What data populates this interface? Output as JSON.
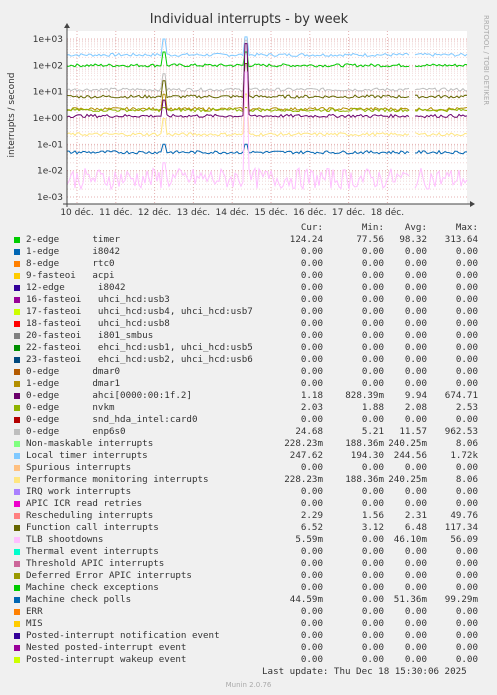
{
  "chart_data": {
    "type": "line",
    "title": "Individual interrupts - by week",
    "ylabel": "interrupts / second",
    "side_label": "RRDTOOL / TOBI OETIKER",
    "y_scale": "log",
    "ylim": [
      0.001,
      1000
    ],
    "y_ticks": [
      "1e+03",
      "1e+02",
      "1e+01",
      "1e+00",
      "1e-01",
      "1e-02",
      "1e-03"
    ],
    "x_ticks": [
      "10 déc.",
      "11 déc.",
      "12 déc.",
      "13 déc.",
      "14 déc.",
      "15 déc.",
      "16 déc.",
      "17 déc.",
      "18 déc."
    ],
    "grid": true,
    "columns": [
      "Cur:",
      "Min:",
      "Avg:",
      "Max:"
    ],
    "series": [
      {
        "name": "2-edge      timer",
        "color": "#00cc00",
        "values": [
          "124.24",
          "77.56",
          "98.32",
          "313.64"
        ]
      },
      {
        "name": "1-edge      i8042",
        "color": "#0066b3",
        "values": [
          "0.00",
          "0.00",
          "0.00",
          "0.00"
        ]
      },
      {
        "name": "8-edge      rtc0",
        "color": "#ff8000",
        "values": [
          "0.00",
          "0.00",
          "0.00",
          "0.00"
        ]
      },
      {
        "name": "9-fasteoi   acpi",
        "color": "#ffcc00",
        "values": [
          "0.00",
          "0.00",
          "0.00",
          "0.00"
        ]
      },
      {
        "name": "12-edge      i8042",
        "color": "#330099",
        "values": [
          "0.00",
          "0.00",
          "0.00",
          "0.00"
        ]
      },
      {
        "name": "16-fasteoi   uhci_hcd:usb3",
        "color": "#990099",
        "values": [
          "0.00",
          "0.00",
          "0.00",
          "0.00"
        ]
      },
      {
        "name": "17-fasteoi   uhci_hcd:usb4, uhci_hcd:usb7",
        "color": "#ccff00",
        "values": [
          "0.00",
          "0.00",
          "0.00",
          "0.00"
        ]
      },
      {
        "name": "18-fasteoi   uhci_hcd:usb8",
        "color": "#ff0000",
        "values": [
          "0.00",
          "0.00",
          "0.00",
          "0.00"
        ]
      },
      {
        "name": "20-fasteoi   i801_smbus",
        "color": "#808080",
        "values": [
          "0.00",
          "0.00",
          "0.00",
          "0.00"
        ]
      },
      {
        "name": "22-fasteoi   ehci_hcd:usb1, uhci_hcd:usb5",
        "color": "#008f00",
        "values": [
          "0.00",
          "0.00",
          "0.00",
          "0.00"
        ]
      },
      {
        "name": "23-fasteoi   ehci_hcd:usb2, uhci_hcd:usb6",
        "color": "#00487d",
        "values": [
          "0.00",
          "0.00",
          "0.00",
          "0.00"
        ]
      },
      {
        "name": "0-edge      dmar0",
        "color": "#b35a00",
        "values": [
          "0.00",
          "0.00",
          "0.00",
          "0.00"
        ]
      },
      {
        "name": "1-edge      dmar1",
        "color": "#b38f00",
        "values": [
          "0.00",
          "0.00",
          "0.00",
          "0.00"
        ]
      },
      {
        "name": "0-edge      ahci[0000:00:1f.2]",
        "color": "#6b006b",
        "values": [
          "1.18",
          "828.39m",
          "9.94",
          "674.71"
        ]
      },
      {
        "name": "0-edge      nvkm",
        "color": "#8fb300",
        "values": [
          "2.03",
          "1.88",
          "2.08",
          "2.53"
        ]
      },
      {
        "name": "0-edge      snd_hda_intel:card0",
        "color": "#b30000",
        "values": [
          "0.00",
          "0.00",
          "0.00",
          "0.00"
        ]
      },
      {
        "name": "0-edge      enp6s0",
        "color": "#bebebe",
        "values": [
          "24.68",
          "5.21",
          "11.57",
          "962.53"
        ]
      },
      {
        "name": "Non-maskable interrupts",
        "color": "#80ff80",
        "values": [
          "228.23m",
          "188.36m",
          "240.25m",
          "8.06"
        ]
      },
      {
        "name": "Local timer interrupts",
        "color": "#80c9ff",
        "values": [
          "247.62",
          "194.30",
          "244.56",
          "1.72k"
        ]
      },
      {
        "name": "Spurious interrupts",
        "color": "#ffc080",
        "values": [
          "0.00",
          "0.00",
          "0.00",
          "0.00"
        ]
      },
      {
        "name": "Performance monitoring interrupts",
        "color": "#ffe680",
        "values": [
          "228.23m",
          "188.36m",
          "240.25m",
          "8.06"
        ]
      },
      {
        "name": "IRQ work interrupts",
        "color": "#aa80ff",
        "values": [
          "0.00",
          "0.00",
          "0.00",
          "0.00"
        ]
      },
      {
        "name": "APIC ICR read retries",
        "color": "#ee00cc",
        "values": [
          "0.00",
          "0.00",
          "0.00",
          "0.00"
        ]
      },
      {
        "name": "Rescheduling interrupts",
        "color": "#ff8080",
        "values": [
          "2.29",
          "1.56",
          "2.31",
          "49.76"
        ]
      },
      {
        "name": "Function call interrupts",
        "color": "#666600",
        "values": [
          "6.52",
          "3.12",
          "6.48",
          "117.34"
        ]
      },
      {
        "name": "TLB shootdowns",
        "color": "#ffbfff",
        "values": [
          "5.59m",
          "0.00",
          "46.10m",
          "56.09"
        ]
      },
      {
        "name": "Thermal event interrupts",
        "color": "#00ffcc",
        "values": [
          "0.00",
          "0.00",
          "0.00",
          "0.00"
        ]
      },
      {
        "name": "Threshold APIC interrupts",
        "color": "#cc6699",
        "values": [
          "0.00",
          "0.00",
          "0.00",
          "0.00"
        ]
      },
      {
        "name": "Deferred Error APIC interrupts",
        "color": "#999900",
        "values": [
          "0.00",
          "0.00",
          "0.00",
          "0.00"
        ]
      },
      {
        "name": "Machine check exceptions",
        "color": "#00cc00",
        "values": [
          "0.00",
          "0.00",
          "0.00",
          "0.00"
        ]
      },
      {
        "name": "Machine check polls",
        "color": "#0066b3",
        "values": [
          "44.59m",
          "0.00",
          "51.36m",
          "99.29m"
        ]
      },
      {
        "name": "ERR",
        "color": "#ff8000",
        "values": [
          "0.00",
          "0.00",
          "0.00",
          "0.00"
        ]
      },
      {
        "name": "MIS",
        "color": "#ffcc00",
        "values": [
          "0.00",
          "0.00",
          "0.00",
          "0.00"
        ]
      },
      {
        "name": "Posted-interrupt notification event",
        "color": "#330099",
        "values": [
          "0.00",
          "0.00",
          "0.00",
          "0.00"
        ]
      },
      {
        "name": "Nested posted-interrupt event",
        "color": "#990099",
        "values": [
          "0.00",
          "0.00",
          "0.00",
          "0.00"
        ]
      },
      {
        "name": "Posted-interrupt wakeup event",
        "color": "#ccff00",
        "values": [
          "0.00",
          "0.00",
          "0.00",
          "0.00"
        ]
      }
    ],
    "plotted": [
      {
        "color": "#80c9ff",
        "level": 250,
        "spike": 1200
      },
      {
        "color": "#00cc00",
        "level": 100,
        "spike": 320
      },
      {
        "color": "#bebebe",
        "level": 12,
        "spike": 900
      },
      {
        "color": "#666600",
        "level": 6.5,
        "spike": 117
      },
      {
        "color": "#b38f00",
        "level": 2.2,
        "spike": 8
      },
      {
        "color": "#8fb300",
        "level": 2.0,
        "spike": 2.5
      },
      {
        "color": "#6b006b",
        "level": 1.2,
        "spike": 670
      },
      {
        "color": "#ffe680",
        "level": 0.24,
        "spike": 8
      },
      {
        "color": "#0066b3",
        "level": 0.05,
        "spike": 0.1
      },
      {
        "color": "#ffbfff",
        "level": 0.005,
        "spike": 56
      }
    ]
  },
  "last_update": "Last update: Thu Dec 18 15:30:06 2025",
  "munin_version": "Munin 2.0.76"
}
